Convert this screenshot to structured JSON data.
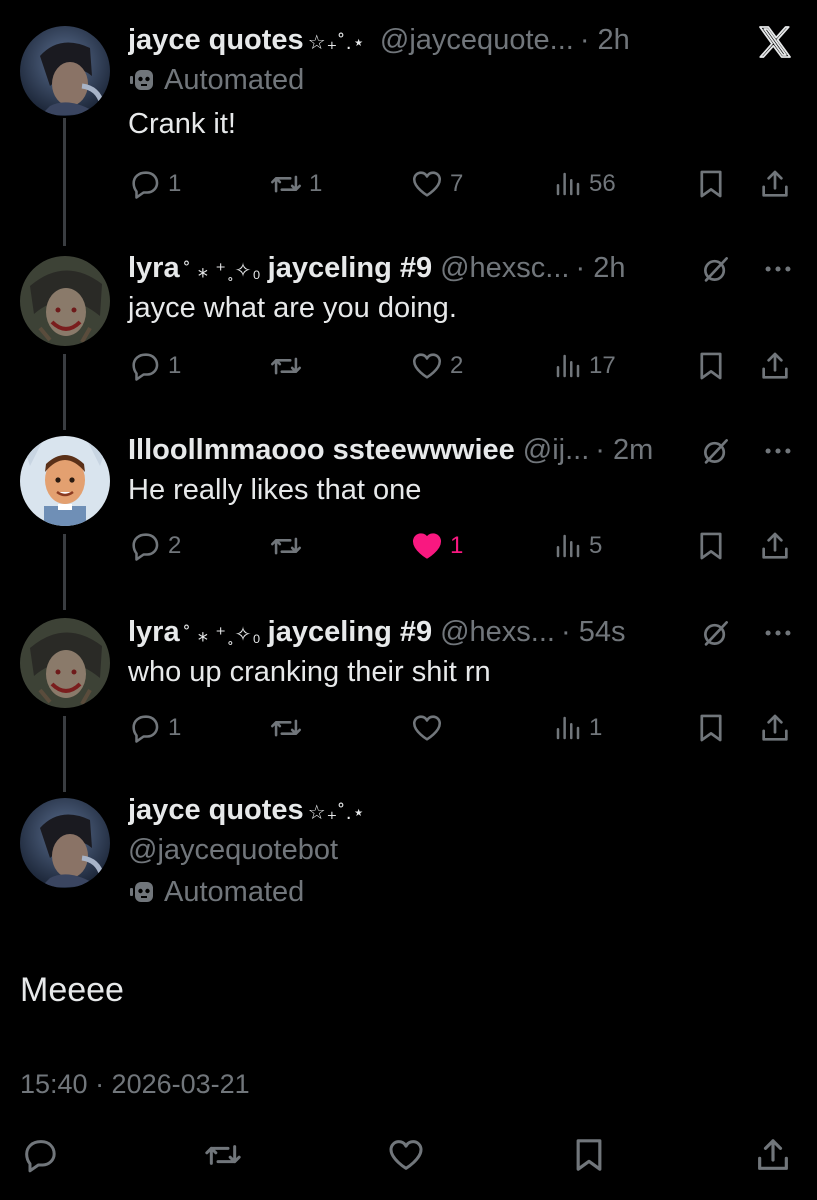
{
  "thread": [
    {
      "name": "jayce quotes",
      "deco": "☆₊˚.⋆",
      "handle": "@jaycequote...",
      "time": "· 2h",
      "automated": "Automated",
      "text": "Crank it!",
      "reply_count": "1",
      "repost_count": "1",
      "like_count": "7",
      "view_count": "56"
    },
    {
      "name": "lyra",
      "deco": "˚ ⁎ ⁺˳✧₀",
      "name2": "jayceling #9",
      "handle": "@hexsc...",
      "time": "· 2h",
      "text": "jayce what are you doing.",
      "reply_count": "1",
      "repost_count": "",
      "like_count": "2",
      "view_count": "17"
    },
    {
      "name": "Illoollmmaooo ssteewwwiee",
      "handle": "@ij...",
      "time": "· 2m",
      "text": "He really likes that one",
      "reply_count": "2",
      "repost_count": "",
      "like_count": "1",
      "liked": true,
      "view_count": "5"
    },
    {
      "name": "lyra",
      "deco": "˚ ⁎ ⁺˳✧₀",
      "name2": "jayceling #9",
      "handle": "@hexs...",
      "time": "· 54s",
      "text": "who up cranking their shit rn",
      "reply_count": "1",
      "repost_count": "",
      "like_count": "",
      "view_count": "1"
    }
  ],
  "main_post": {
    "name": "jayce quotes",
    "deco": "☆₊˚.⋆",
    "handle": "@jaycequotebot",
    "automated": "Automated",
    "text": "Meeee",
    "timestamp": "15:40 · 2026-03-21"
  },
  "colors": {
    "background": "#000000",
    "text": "#e7e9ea",
    "muted": "#71767b",
    "like_active": "#f91880",
    "thread_line": "#3a3d41"
  }
}
